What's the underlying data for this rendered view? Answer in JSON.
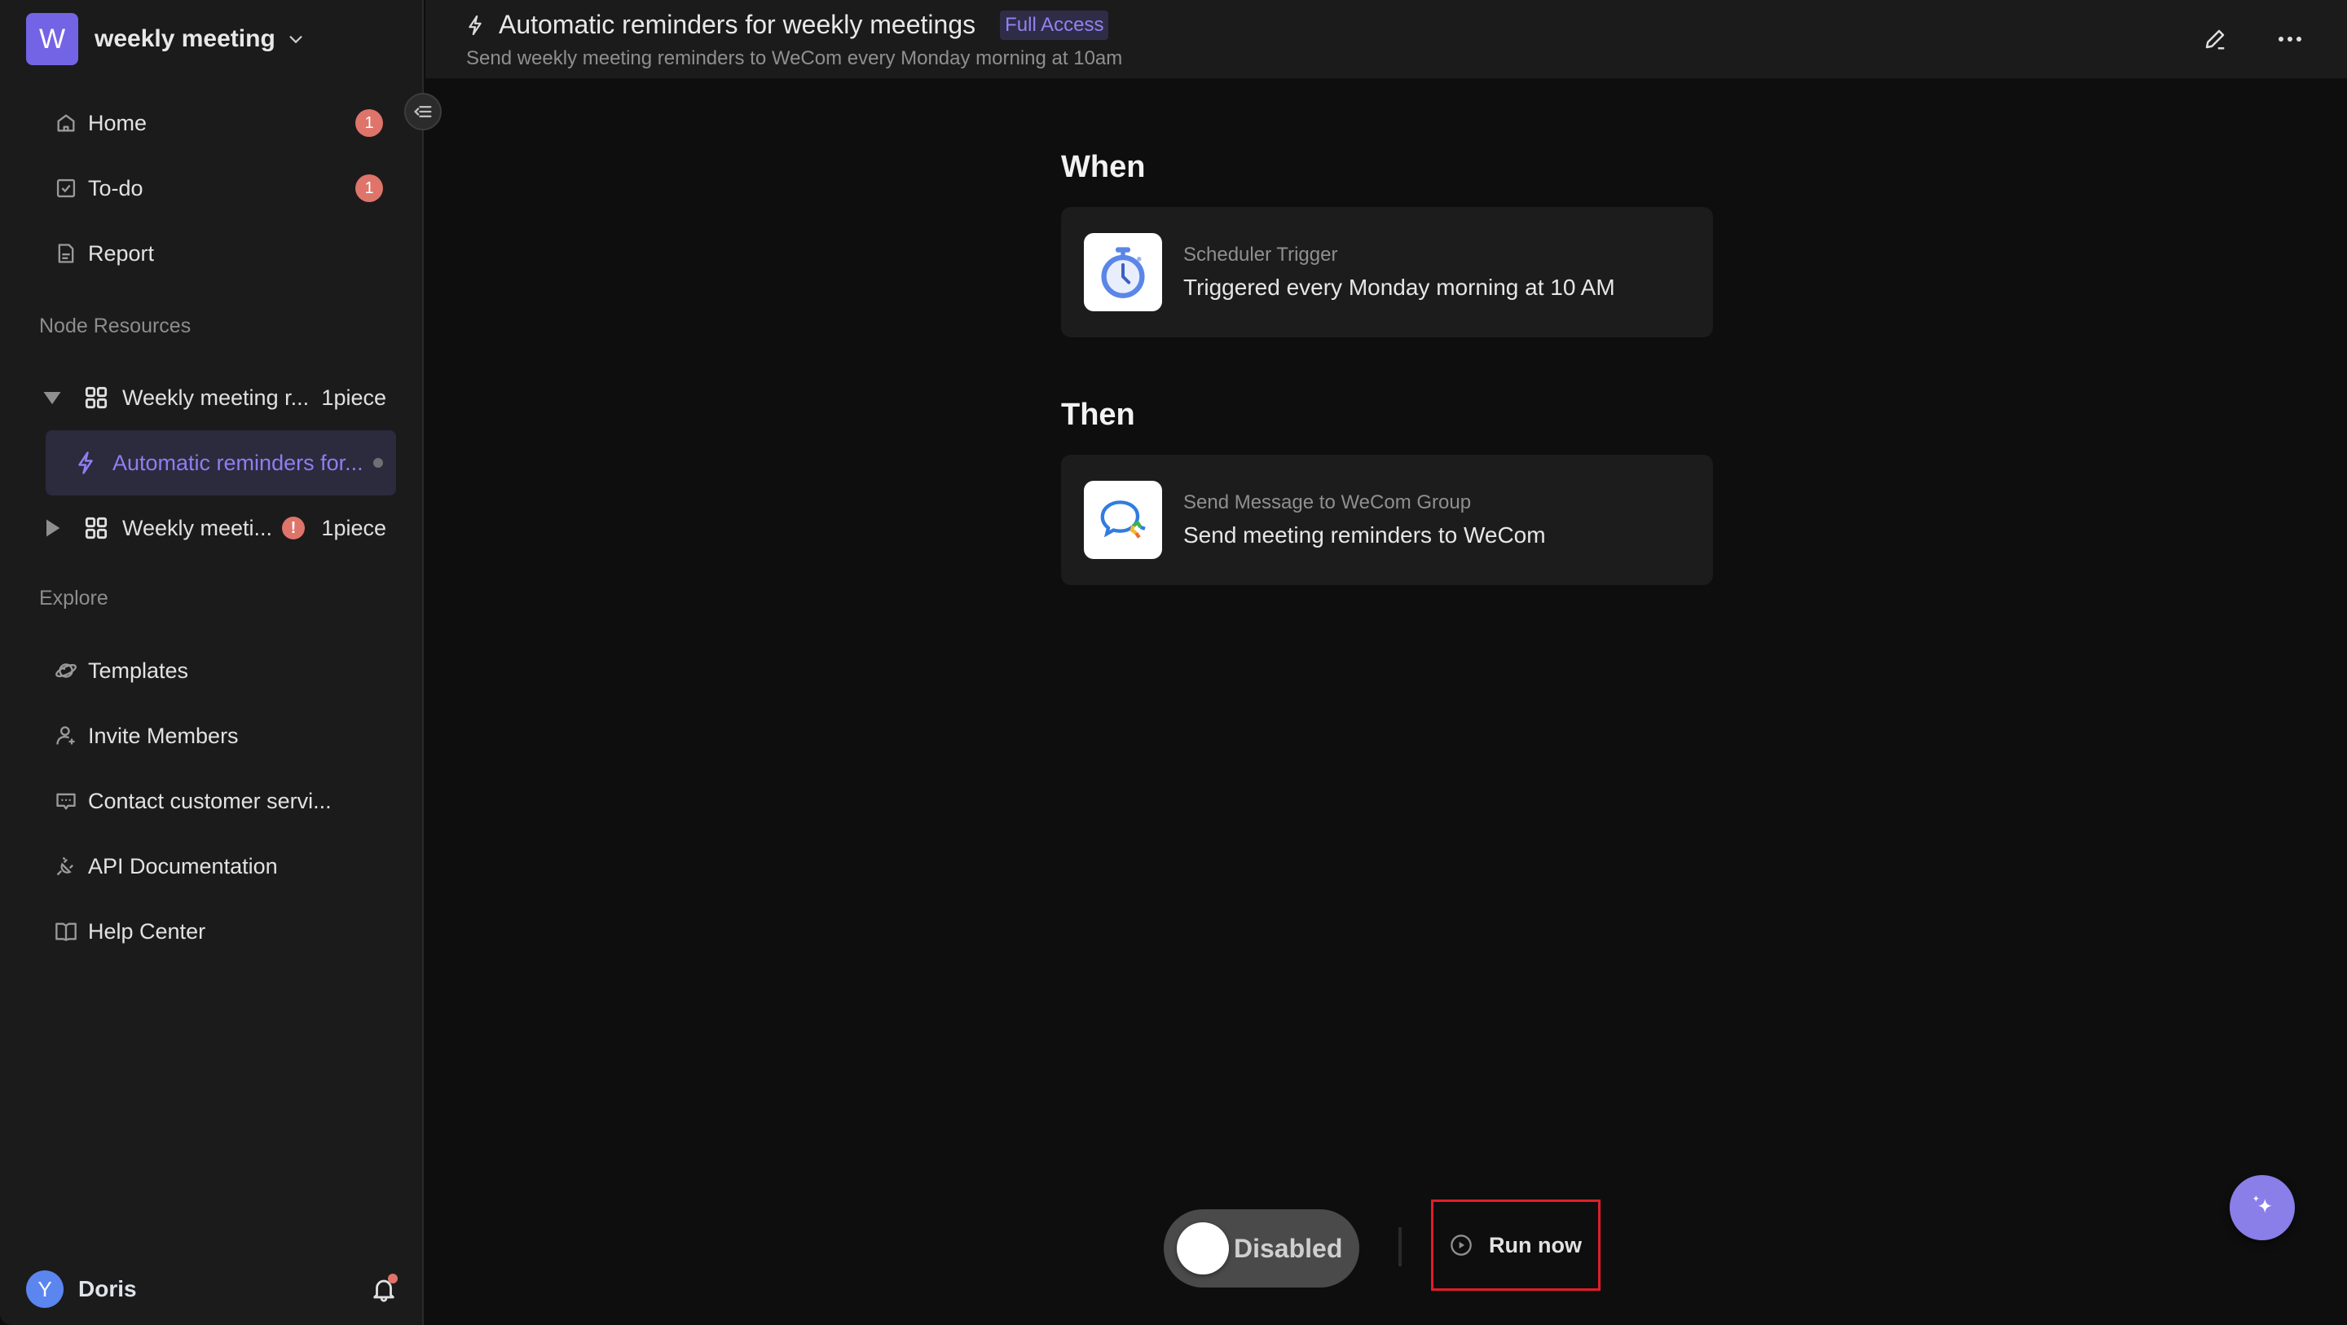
{
  "workspace": {
    "initial": "W",
    "name": "weekly meeting",
    "brand_color": "#7364e6"
  },
  "nav": {
    "items": [
      {
        "label": "Home",
        "icon": "home-icon",
        "badge": "1"
      },
      {
        "label": "To-do",
        "icon": "checkbox-icon",
        "badge": "1"
      },
      {
        "label": "Report",
        "icon": "document-icon",
        "badge": null
      }
    ]
  },
  "node_resources": {
    "label": "Node Resources",
    "folders": [
      {
        "label": "Weekly meeting r...",
        "count": "1piece",
        "expanded": true,
        "warning": false,
        "children": [
          {
            "label": "Automatic reminders for...",
            "icon": "bolt-icon",
            "selected": true
          }
        ]
      },
      {
        "label": "Weekly meeti...",
        "count": "1piece",
        "expanded": false,
        "warning": true,
        "warning_glyph": "!"
      }
    ]
  },
  "explore": {
    "label": "Explore",
    "items": [
      {
        "label": "Templates",
        "icon": "planet-icon"
      },
      {
        "label": "Invite Members",
        "icon": "user-plus-icon"
      },
      {
        "label": "Contact customer servi...",
        "icon": "chat-icon"
      },
      {
        "label": "API Documentation",
        "icon": "plug-icon"
      },
      {
        "label": "Help Center",
        "icon": "book-icon"
      }
    ]
  },
  "user": {
    "initial": "Y",
    "name": "Doris",
    "has_notification": true
  },
  "header": {
    "title": "Automatic reminders for weekly meetings",
    "access_badge": "Full Access",
    "subtitle": "Send weekly meeting reminders to WeCom every Monday morning at 10am"
  },
  "flow": {
    "when": {
      "heading": "When",
      "card": {
        "type": "Scheduler Trigger",
        "description": "Triggered every Monday morning at 10 AM",
        "icon": "stopwatch-icon"
      }
    },
    "then": {
      "heading": "Then",
      "card": {
        "type": "Send Message to WeCom Group",
        "description": "Send meeting reminders to WeCom",
        "icon": "wecom-icon"
      }
    }
  },
  "controls": {
    "toggle_label": "Disabled",
    "toggle_on": false,
    "run_label": "Run now"
  },
  "colors": {
    "accent": "#8a7ee9",
    "badge_red": "#de746a",
    "highlight_box": "#e11d2a"
  }
}
